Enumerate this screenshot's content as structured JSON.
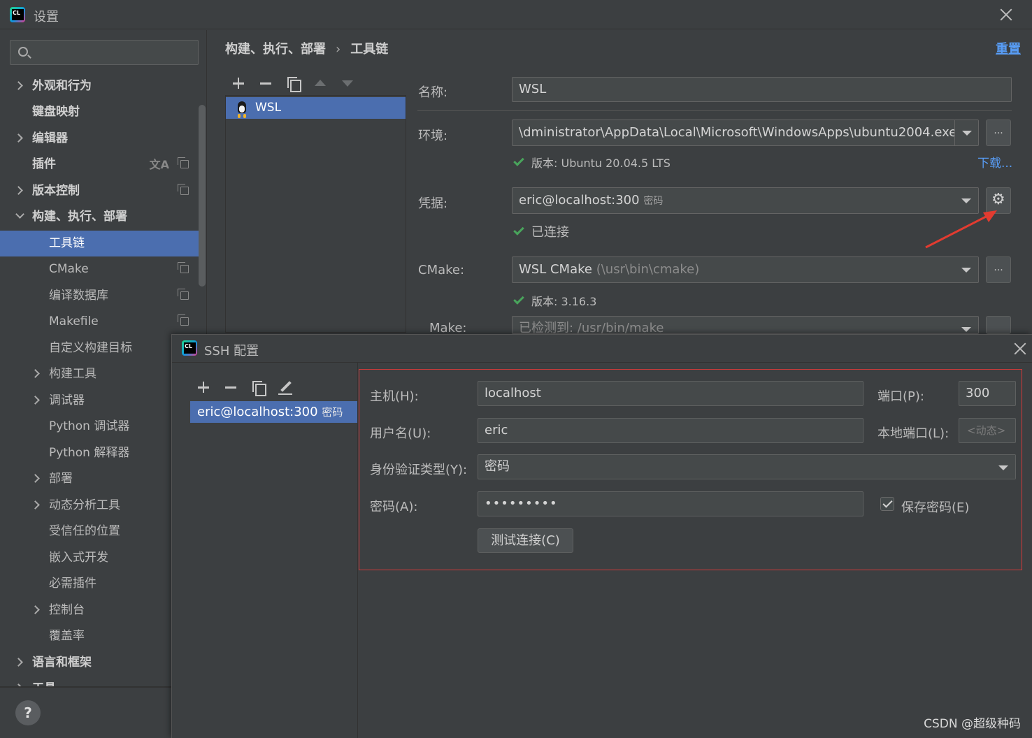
{
  "window": {
    "title": "设置"
  },
  "sidebar": {
    "search_placeholder": "",
    "items": [
      {
        "label": "外观和行为"
      },
      {
        "label": "键盘映射"
      },
      {
        "label": "编辑器"
      },
      {
        "label": "插件"
      },
      {
        "label": "版本控制"
      },
      {
        "label": "构建、执行、部署"
      },
      {
        "label": "工具链"
      },
      {
        "label": "CMake"
      },
      {
        "label": "编译数据库"
      },
      {
        "label": "Makefile"
      },
      {
        "label": "自定义构建目标"
      },
      {
        "label": "构建工具"
      },
      {
        "label": "调试器"
      },
      {
        "label": "Python 调试器"
      },
      {
        "label": "Python 解释器"
      },
      {
        "label": "部署"
      },
      {
        "label": "动态分析工具"
      },
      {
        "label": "受信任的位置"
      },
      {
        "label": "嵌入式开发"
      },
      {
        "label": "必需插件"
      },
      {
        "label": "控制台"
      },
      {
        "label": "覆盖率"
      },
      {
        "label": "语言和框架"
      },
      {
        "label": "工具"
      }
    ],
    "help_label": "?"
  },
  "breadcrumb": {
    "parent": "构建、执行、部署",
    "separator": "›",
    "current": "工具链"
  },
  "reset_label": "重置",
  "toolchains": {
    "items": [
      {
        "label": "WSL"
      }
    ]
  },
  "form": {
    "name_label": "名称:",
    "name_value": "WSL",
    "env_label": "环境:",
    "env_value": "\\dministrator\\AppData\\Local\\Microsoft\\WindowsApps\\ubuntu2004.exe",
    "env_version": "版本: Ubuntu 20.04.5 LTS",
    "download_label": "下载...",
    "cred_label": "凭据:",
    "cred_value": "eric@localhost:300",
    "cred_hint": "密码",
    "cred_status": "已连接",
    "cmake_label": "CMake:",
    "cmake_value": "WSL CMake",
    "cmake_hint": "(\\usr\\bin\\cmake)",
    "cmake_version": "版本: 3.16.3",
    "make_label": "Make:",
    "make_value": "已检测到: /usr/bin/make",
    "ellipsis": "..."
  },
  "ssh_dialog": {
    "title": "SSH 配置",
    "list": [
      {
        "label": "eric@localhost:300",
        "hint": "密码"
      }
    ],
    "host_label": "主机(H):",
    "host_value": "localhost",
    "port_label": "端口(P):",
    "port_value": "300",
    "user_label": "用户名(U):",
    "user_value": "eric",
    "local_port_label": "本地端口(L):",
    "local_port_placeholder": "<动态>",
    "auth_label": "身份验证类型(Y):",
    "auth_value": "密码",
    "password_label": "密码(A):",
    "password_value": "•••••••••",
    "save_password_label": "保存密码(E)",
    "save_password_checked": true,
    "test_button": "测试连接(C)"
  },
  "watermark": "CSDN @超级种码",
  "colors": {
    "selection": "#4b6eaf",
    "link": "#589df6",
    "ok": "#49a45c",
    "highlight_box": "#d03a3a",
    "annotation_arrow": "#e23b30"
  }
}
